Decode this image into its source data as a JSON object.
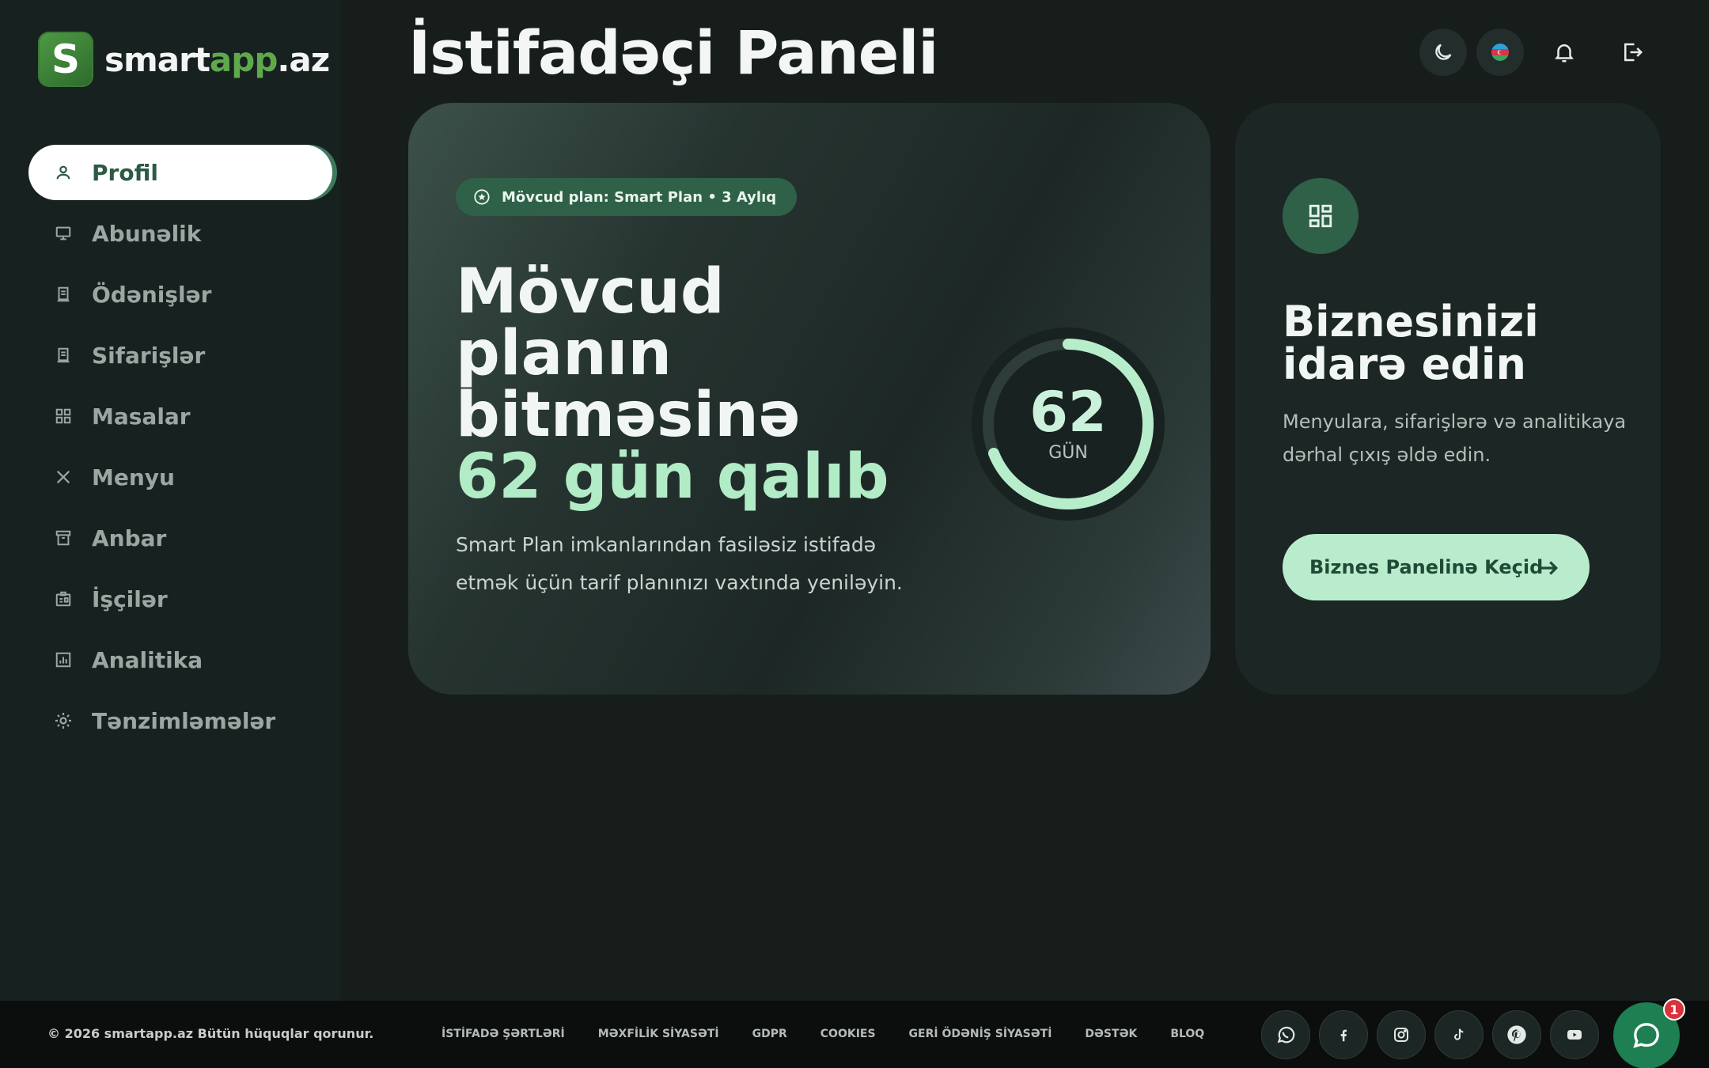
{
  "brand": {
    "name_main": "smart",
    "name_accent": "app",
    "name_suffix": ".az",
    "logo_letter": "S"
  },
  "header": {
    "title": "İstifadəçi Paneli"
  },
  "sidebar": {
    "items": [
      {
        "label": "Profil",
        "icon": "user-icon",
        "active": true
      },
      {
        "label": "Abunəlik",
        "icon": "subscription-icon"
      },
      {
        "label": "Ödənişlər",
        "icon": "receipt-icon"
      },
      {
        "label": "Sifarişlər",
        "icon": "orders-icon"
      },
      {
        "label": "Masalar",
        "icon": "grid-icon"
      },
      {
        "label": "Menyu",
        "icon": "utensils-icon"
      },
      {
        "label": "Anbar",
        "icon": "archive-icon"
      },
      {
        "label": "İşçilər",
        "icon": "badge-icon"
      },
      {
        "label": "Analitika",
        "icon": "chart-icon"
      },
      {
        "label": "Tənzimləmələr",
        "icon": "gear-icon"
      }
    ]
  },
  "plan_card": {
    "pill": "Mövcud plan: Smart Plan • 3 Aylıq",
    "hero_prefix": "Mövcud planın bitməsinə",
    "hero_days": "62",
    "hero_suffix": "gün qalıb",
    "subtitle": "Smart Plan imkanlarından fasiləsiz istifadə etmək üçün tarif planınızı vaxtında yeniləyin.",
    "ring_value": "62",
    "ring_label": "GÜN",
    "ring_fill": 0.69
  },
  "side_card": {
    "title": "Biznesinizi idarə edin",
    "subtitle": "Menyulara, sifarişlərə və analitikaya dərhal çıxış əldə edin.",
    "button": "Biznes Panelinə Keçid"
  },
  "footer": {
    "copyright": "© 2026 smartapp.az Bütün hüquqlar qorunur.",
    "links": [
      "İSTİFADƏ ŞƏRTLƏRİ",
      "MƏXFİLİK SİYASƏTİ",
      "GDPR",
      "COOKIES",
      "GERİ ÖDƏNİŞ SİYASƏTİ",
      "DƏSTƏK",
      "BLOQ"
    ],
    "socials": [
      "whatsapp-icon",
      "facebook-icon",
      "instagram-icon",
      "tiktok-icon",
      "pinterest-icon",
      "youtube-icon"
    ]
  },
  "chat": {
    "badge": "1"
  },
  "colors": {
    "accent": "#b2ecc7",
    "brand_green": "#2e6148",
    "background": "#161d1b"
  }
}
